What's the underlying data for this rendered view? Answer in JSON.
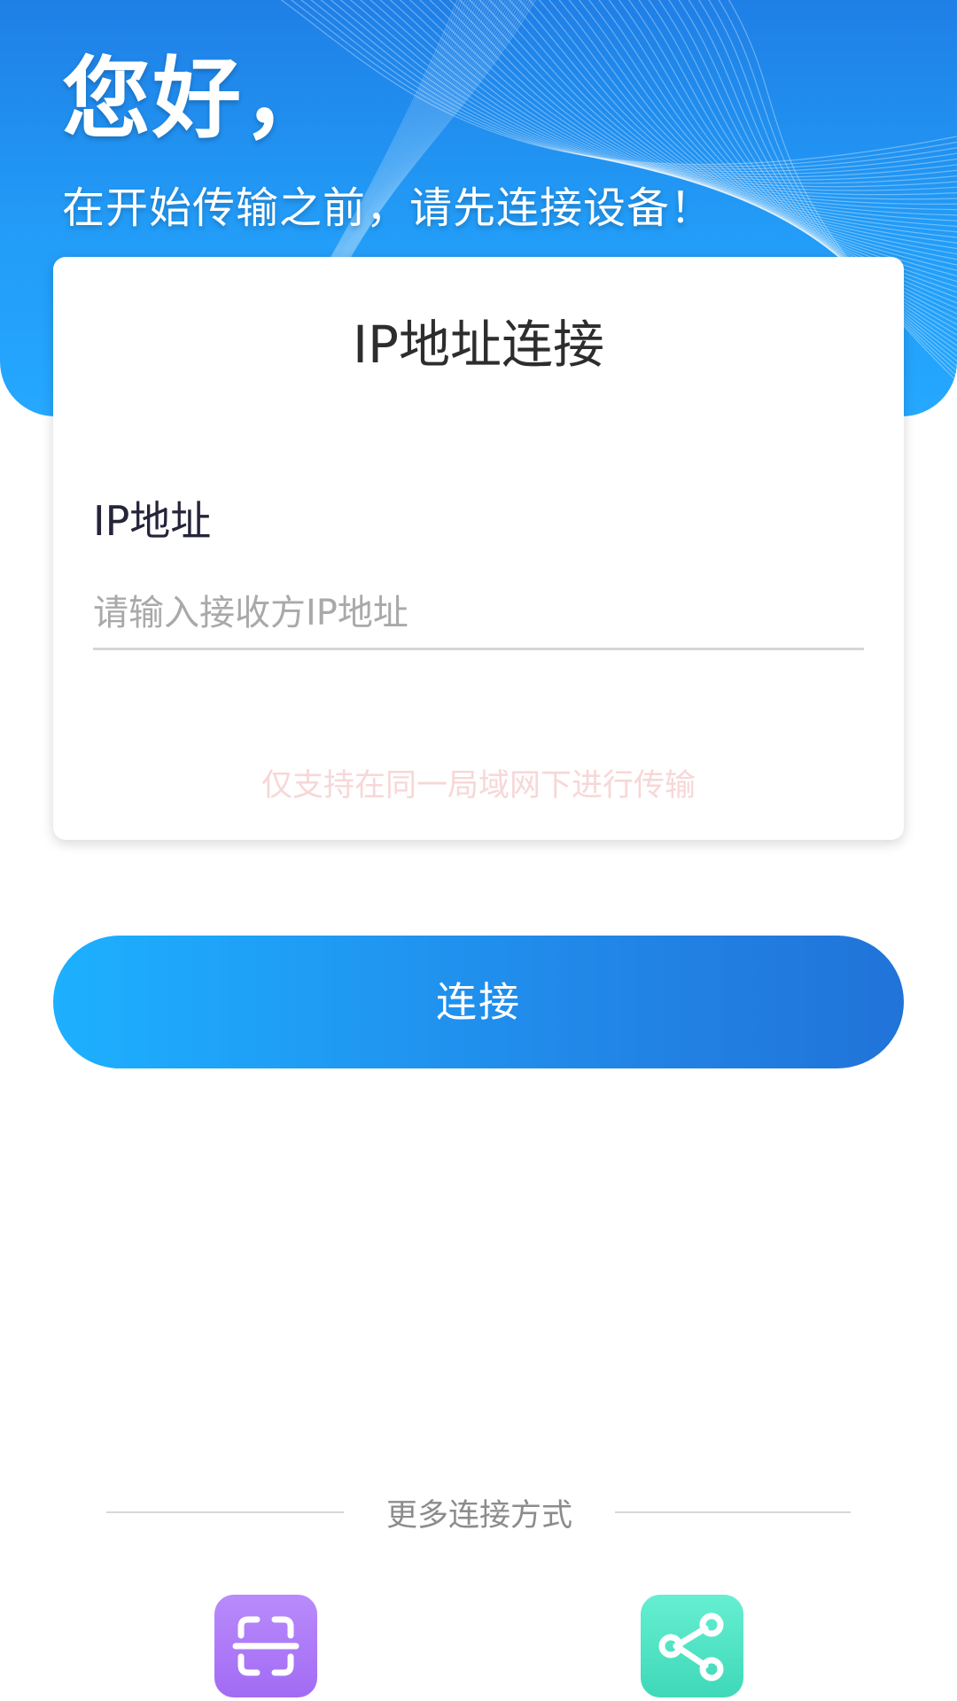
{
  "header": {
    "greeting": "您好，",
    "subtitle": "在开始传输之前，请先连接设备！"
  },
  "card": {
    "title": "IP地址连接",
    "field_label": "IP地址",
    "input_value": "",
    "input_placeholder": "请输入接收方IP地址",
    "hint": "仅支持在同一局域网下进行传输"
  },
  "connect_button": {
    "label": "连接"
  },
  "more_methods": {
    "label": "更多连接方式",
    "items": [
      {
        "icon": "scan-icon",
        "color": "#a774f6"
      },
      {
        "icon": "share-icon",
        "color": "#4ee2c3"
      }
    ]
  },
  "colors": {
    "header_blue": "#229cf7",
    "button_start": "#1db0ff",
    "button_end": "#2173d8",
    "hint_text": "#f7d7d7"
  }
}
